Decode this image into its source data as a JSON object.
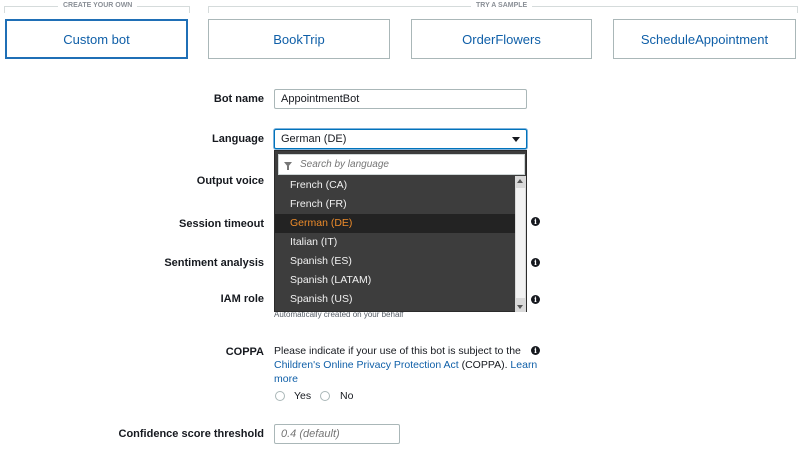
{
  "sections": {
    "create_own": "CREATE YOUR OWN",
    "try_sample": "TRY A SAMPLE"
  },
  "cards": {
    "custom": "Custom bot",
    "samples": [
      "BookTrip",
      "OrderFlowers",
      "ScheduleAppointment"
    ]
  },
  "form": {
    "bot_name_label": "Bot name",
    "bot_name_value": "AppointmentBot",
    "language_label": "Language",
    "language_value": "German (DE)",
    "output_voice_label": "Output voice",
    "session_timeout_label": "Session timeout",
    "sentiment_label": "Sentiment analysis",
    "iam_label": "IAM role",
    "iam_note": "Automatically created on your behalf",
    "coppa_label": "COPPA",
    "coppa_text_1": "Please indicate if your use of this bot is subject to the",
    "coppa_link": "Children's Online Privacy Protection Act",
    "coppa_text_2": "(COPPA).",
    "coppa_link_2a": "Learn",
    "coppa_link_2b": "more",
    "yes_label": "Yes",
    "no_label": "No",
    "confidence_label": "Confidence score threshold",
    "confidence_placeholder": "0.4 (default)"
  },
  "dropdown": {
    "search_placeholder": "Search by language",
    "items": [
      "French (CA)",
      "French (FR)",
      "German (DE)",
      "Italian (IT)",
      "Spanish (ES)",
      "Spanish (LATAM)",
      "Spanish (US)"
    ],
    "selected": "German (DE)"
  },
  "info_glyph": "i",
  "colors": {
    "link": "#0f5fa8",
    "selected_border": "#1f6fb6",
    "dropdown_bg": "#3d3d3d",
    "dropdown_active_text": "#ec8b2a"
  }
}
